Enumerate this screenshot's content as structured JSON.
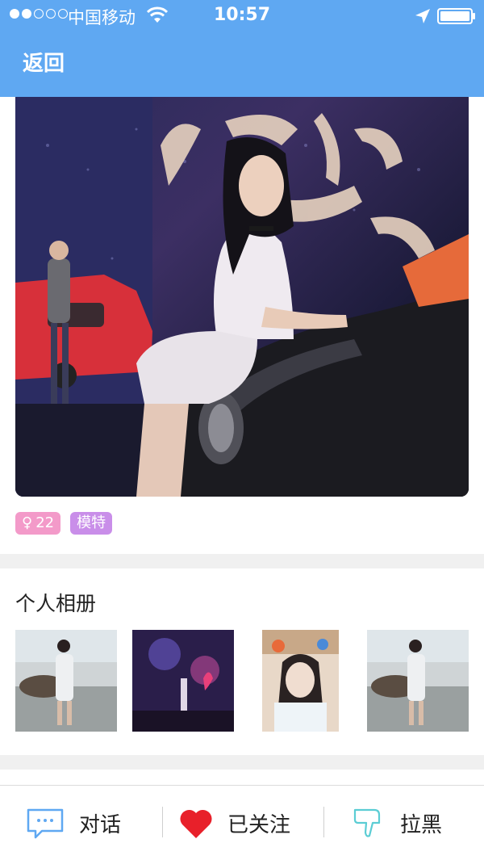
{
  "status_bar": {
    "carrier": "中国移动",
    "time": "10:57",
    "signal_bars_filled": 2,
    "signal_bars_total": 5
  },
  "nav": {
    "back_label": "返回"
  },
  "profile": {
    "tags": {
      "age_symbol": "♀",
      "age": "22",
      "occupation": "模特"
    }
  },
  "album": {
    "title": "个人相册",
    "photos": [
      "beach-photo",
      "stage-photo",
      "selfie-photo",
      "beach-photo"
    ]
  },
  "actions": {
    "chat_label": "对话",
    "follow_label": "已关注",
    "block_label": "拉黑"
  },
  "colors": {
    "nav_bg": "#5fa8f2",
    "age_tag": "#f39ac9",
    "job_tag": "#c98ee9",
    "heart": "#e8202a",
    "chat_icon": "#5fa8f2",
    "dislike_icon": "#5bcdd4"
  }
}
